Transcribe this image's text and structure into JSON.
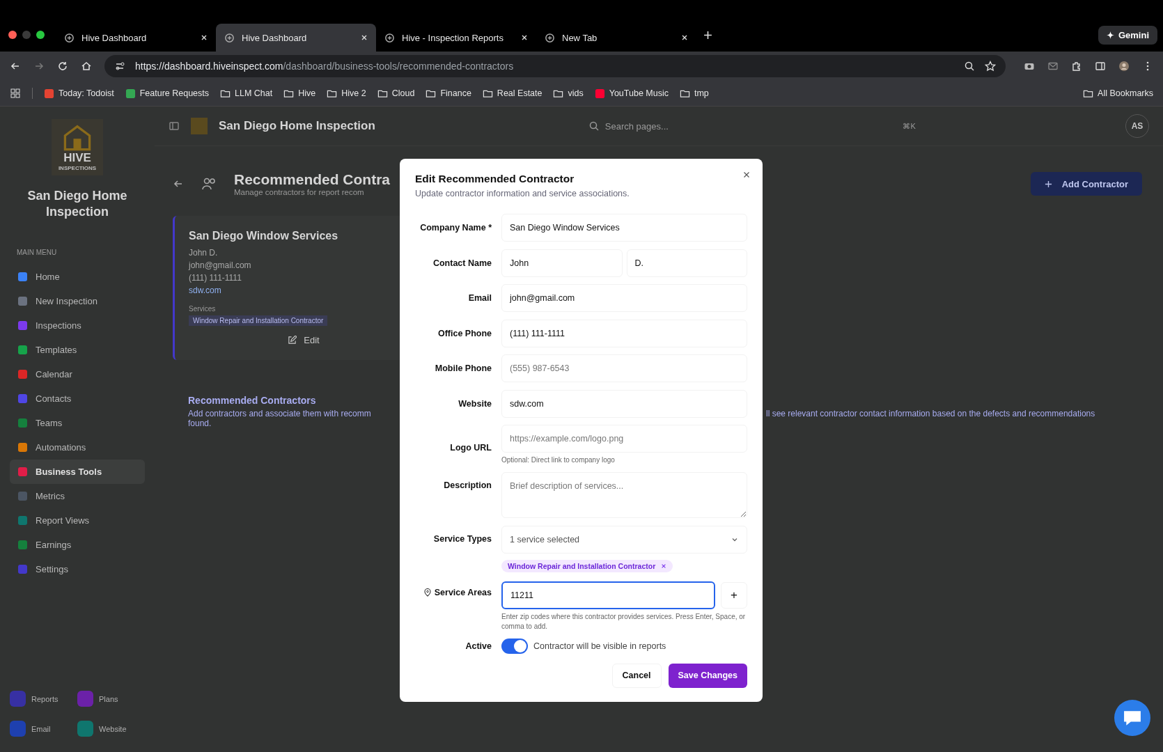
{
  "browser": {
    "tabs": [
      {
        "title": "Hive Dashboard",
        "selected": false
      },
      {
        "title": "Hive Dashboard",
        "selected": true
      },
      {
        "title": "Hive - Inspection Reports",
        "selected": false
      },
      {
        "title": "New Tab",
        "selected": false
      }
    ],
    "gemini": "Gemini",
    "url": {
      "host": "https://dashboard.hiveinspect.com",
      "path": "/dashboard/business-tools/recommended-contractors"
    },
    "bookmarks": [
      {
        "label": "Today: Todoist",
        "kind": "app",
        "color": "#e44332"
      },
      {
        "label": "Feature Requests",
        "kind": "app",
        "color": "#34a853"
      },
      {
        "label": "LLM Chat",
        "kind": "folder"
      },
      {
        "label": "Hive",
        "kind": "folder"
      },
      {
        "label": "Hive 2",
        "kind": "folder"
      },
      {
        "label": "Cloud",
        "kind": "folder"
      },
      {
        "label": "Finance",
        "kind": "folder"
      },
      {
        "label": "Real Estate",
        "kind": "folder"
      },
      {
        "label": "vids",
        "kind": "folder"
      },
      {
        "label": "YouTube Music",
        "kind": "app",
        "color": "#ff0033"
      },
      {
        "label": "tmp",
        "kind": "folder"
      }
    ],
    "all_bookmarks": "All Bookmarks"
  },
  "sidebar": {
    "logo_word": "HIVE",
    "logo_sub": "INSPECTIONS",
    "company": "San Diego Home Inspection",
    "menu_label": "MAIN MENU",
    "items": [
      {
        "label": "Home",
        "selected": false,
        "color": "#3b82f6"
      },
      {
        "label": "New Inspection",
        "selected": false,
        "color": "#6b7280"
      },
      {
        "label": "Inspections",
        "selected": false,
        "color": "#7c3aed"
      },
      {
        "label": "Templates",
        "selected": false,
        "color": "#16a34a"
      },
      {
        "label": "Calendar",
        "selected": false,
        "color": "#dc2626"
      },
      {
        "label": "Contacts",
        "selected": false,
        "color": "#4f46e5"
      },
      {
        "label": "Teams",
        "selected": false,
        "color": "#15803d"
      },
      {
        "label": "Automations",
        "selected": false,
        "color": "#d97706"
      },
      {
        "label": "Business Tools",
        "selected": true,
        "color": "#e11d48"
      },
      {
        "label": "Metrics",
        "selected": false,
        "color": "#4b5563"
      },
      {
        "label": "Report Views",
        "selected": false,
        "color": "#0f766e"
      },
      {
        "label": "Earnings",
        "selected": false,
        "color": "#15803d"
      },
      {
        "label": "Settings",
        "selected": false,
        "color": "#4338ca"
      }
    ],
    "shortcuts": [
      {
        "label": "Reports",
        "color": "#3730a3"
      },
      {
        "label": "Plans",
        "color": "#6b21a8"
      },
      {
        "label": "Email",
        "color": "#1e40af"
      },
      {
        "label": "Website",
        "color": "#0f766e"
      }
    ]
  },
  "header": {
    "title": "San Diego Home Inspection",
    "search_placeholder": "Search pages...",
    "shortcut": "⌘K",
    "avatar": "AS"
  },
  "page": {
    "title": "Recommended Contra",
    "subtitle": "Manage contractors for report recom",
    "add_button": "Add Contractor"
  },
  "card": {
    "name": "San Diego Window Services",
    "contact": "John D.",
    "email": "john@gmail.com",
    "phone": "(111) 111-1111",
    "website": "sdw.com",
    "services_label": "Services",
    "service": "Window Repair and Installation Contractor",
    "edit": "Edit"
  },
  "info": {
    "title": "Recommended Contractors",
    "text_left": "Add contractors and associate them with recomm",
    "text_left_2": "found.",
    "text_right": "ll see relevant contractor contact information based on the defects and recommendations"
  },
  "modal": {
    "title": "Edit Recommended Contractor",
    "subtitle": "Update contractor information and service associations.",
    "company": {
      "label": "Company Name *",
      "value": "San Diego Window Services"
    },
    "contact": {
      "label": "Contact Name",
      "first": "John",
      "last": "D."
    },
    "email": {
      "label": "Email",
      "value": "john@gmail.com"
    },
    "office_phone": {
      "label": "Office Phone",
      "value": "(111) 111-1111"
    },
    "mobile_phone": {
      "label": "Mobile Phone",
      "placeholder": "(555) 987-6543"
    },
    "website": {
      "label": "Website",
      "value": "sdw.com"
    },
    "logo": {
      "label": "Logo URL",
      "placeholder": "https://example.com/logo.png",
      "hint": "Optional: Direct link to company logo"
    },
    "description": {
      "label": "Description",
      "placeholder": "Brief description of services..."
    },
    "service_types": {
      "label": "Service Types",
      "value": "1 service selected",
      "tags": [
        "Window Repair and Installation Contractor"
      ]
    },
    "service_areas": {
      "label": "Service Areas",
      "value": "11211",
      "add": "+",
      "hint": "Enter zip codes where this contractor provides services. Press Enter, Space, or comma to add."
    },
    "active": {
      "label": "Active",
      "on": true,
      "text": "Contractor will be visible in reports"
    },
    "cancel": "Cancel",
    "save": "Save Changes"
  }
}
